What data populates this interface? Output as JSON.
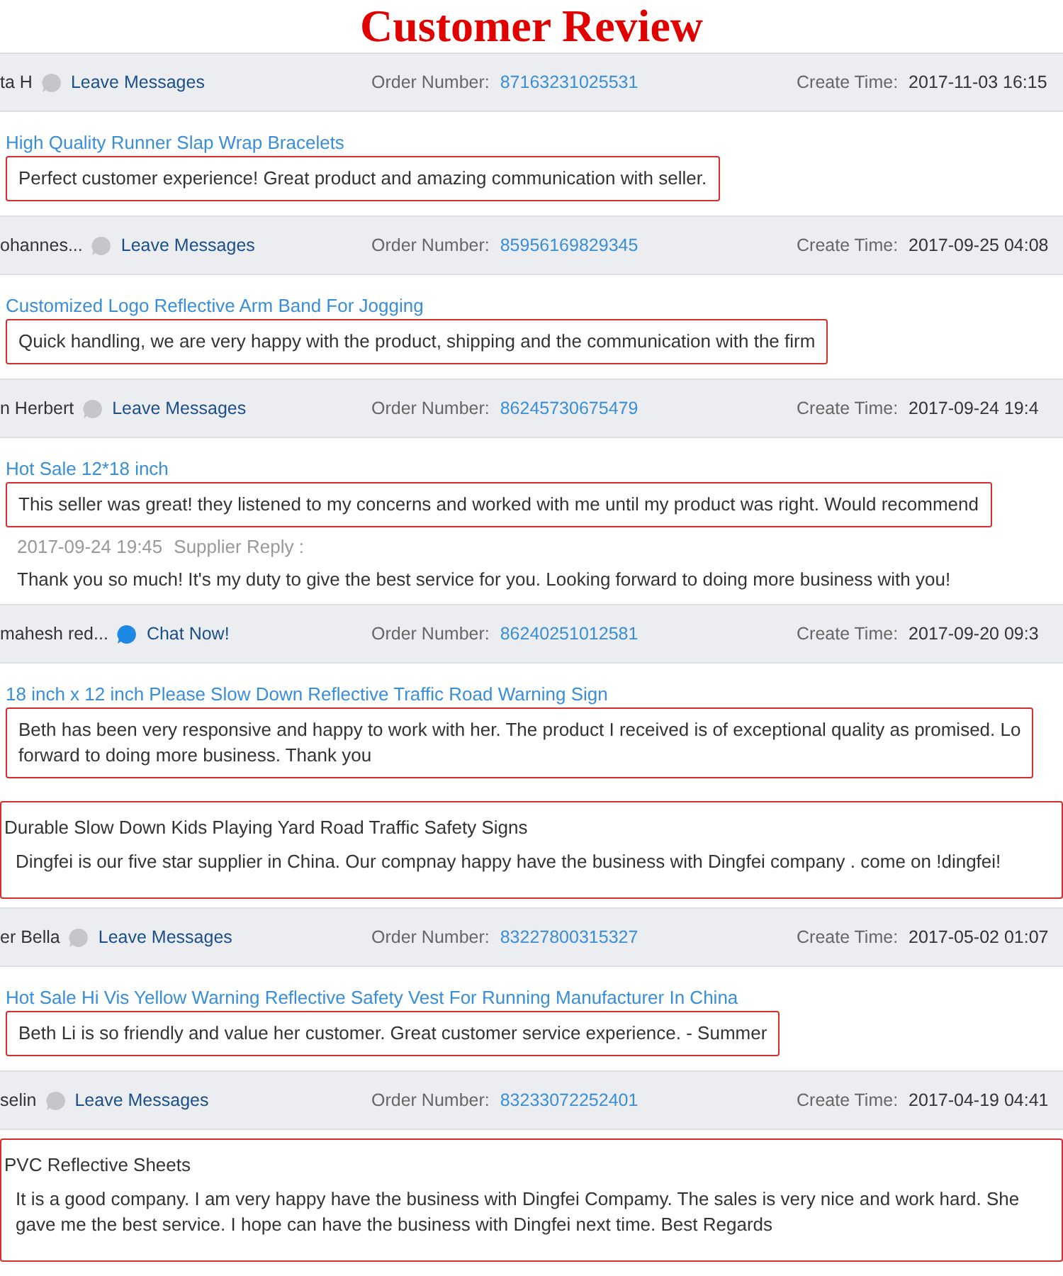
{
  "title": "Customer Review",
  "reviews": [
    {
      "buyer": "ta H",
      "contact": {
        "kind": "leave",
        "label": "Leave Messages"
      },
      "order_label": "Order Number:",
      "order_number": "87163231025531",
      "time_label": "Create Time:",
      "time": "2017-11-03 16:15",
      "product": "High Quality Runner Slap Wrap Bracelets",
      "product_link": true,
      "kind": "review",
      "review": "Perfect customer experience! Great product and amazing communication with seller."
    },
    {
      "buyer": "ohannes...",
      "contact": {
        "kind": "leave",
        "label": "Leave Messages"
      },
      "order_label": "Order Number:",
      "order_number": "85956169829345",
      "time_label": "Create Time:",
      "time": "2017-09-25 04:08",
      "product": "Customized Logo Reflective Arm Band For Jogging",
      "product_link": true,
      "kind": "review",
      "review": "Quick handling, we are very happy with the product, shipping and the communication with the firm"
    },
    {
      "buyer": "n Herbert",
      "contact": {
        "kind": "leave",
        "label": "Leave Messages"
      },
      "order_label": "Order Number:",
      "order_number": "86245730675479",
      "time_label": "Create Time:",
      "time": "2017-09-24 19:4",
      "product": "Hot Sale 12*18 inch",
      "product_link": true,
      "kind": "review",
      "review": "This seller was great! they listened to my concerns and worked with me until my product was right. Would recommend",
      "reply": {
        "time": "2017-09-24 19:45",
        "label": "Supplier Reply :",
        "text": "Thank you so much! It's my duty to give the best service for you. Looking forward to doing more business with you!"
      }
    },
    {
      "buyer": "mahesh red...",
      "contact": {
        "kind": "chat",
        "label": "Chat Now!"
      },
      "order_label": "Order Number:",
      "order_number": "86240251012581",
      "time_label": "Create Time:",
      "time": "2017-09-20 09:3",
      "product": "18 inch x 12 inch Please Slow Down Reflective Traffic Road Warning Sign",
      "product_link": true,
      "kind": "review",
      "review": "Beth has been very responsive and happy to work with her. The product I received is of exceptional quality as promised. Lo\nforward to doing more business. Thank you"
    },
    {
      "product": "Durable Slow Down Kids Playing Yard Road Traffic Safety Signs",
      "product_link": false,
      "kind": "block",
      "review": "Dingfei is our five star supplier in China. Our compnay happy have the business with Dingfei company . come on !dingfei!"
    },
    {
      "buyer": "er Bella",
      "contact": {
        "kind": "leave",
        "label": "Leave Messages"
      },
      "order_label": "Order Number:",
      "order_number": "83227800315327",
      "time_label": "Create Time:",
      "time": "2017-05-02 01:07",
      "product": "Hot Sale Hi Vis Yellow Warning Reflective Safety Vest For Running Manufacturer In China",
      "product_link": true,
      "kind": "review",
      "review": "Beth Li is so friendly and value her customer. Great customer service experience. - Summer"
    },
    {
      "buyer": "selin",
      "contact": {
        "kind": "leave",
        "label": "Leave Messages"
      },
      "order_label": "Order Number:",
      "order_number": "83233072252401",
      "time_label": "Create Time:",
      "time": "2017-04-19 04:41",
      "product": "PVC Reflective Sheets",
      "product_link": false,
      "kind": "block",
      "review": "It is a good company. I am very happy have the business with Dingfei Compamy. The sales is very nice and work hard. She gave me the best service. I hope can have the business with Dingfei next time. Best Regards"
    }
  ]
}
